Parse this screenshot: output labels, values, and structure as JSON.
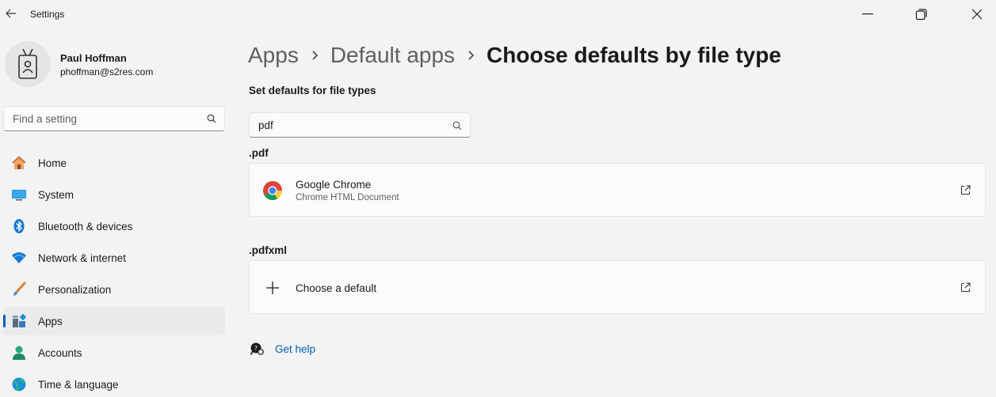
{
  "window": {
    "title": "Settings"
  },
  "profile": {
    "name": "Paul Hoffman",
    "email": "phoffman@s2res.com"
  },
  "search": {
    "placeholder": "Find a setting"
  },
  "nav": [
    {
      "label": "Home",
      "icon": "home-icon"
    },
    {
      "label": "System",
      "icon": "system-icon"
    },
    {
      "label": "Bluetooth & devices",
      "icon": "bluetooth-icon"
    },
    {
      "label": "Network & internet",
      "icon": "wifi-icon"
    },
    {
      "label": "Personalization",
      "icon": "brush-icon"
    },
    {
      "label": "Apps",
      "icon": "apps-icon",
      "active": true
    },
    {
      "label": "Accounts",
      "icon": "accounts-icon"
    },
    {
      "label": "Time & language",
      "icon": "globe-icon"
    }
  ],
  "breadcrumb": {
    "items": [
      "Apps",
      "Default apps",
      "Choose defaults by file type"
    ]
  },
  "main": {
    "section_title": "Set defaults for file types",
    "filter_value": "pdf",
    "groups": [
      {
        "extension": ".pdf",
        "app_name": "Google Chrome",
        "app_sub": "Chrome HTML Document",
        "icon": "chrome-icon"
      },
      {
        "extension": ".pdfxml",
        "app_name": "Choose a default",
        "icon": "plus-icon"
      }
    ],
    "help_label": "Get help"
  },
  "colors": {
    "accent": "#005fb8",
    "background": "#f3f3f3",
    "card": "#fbfbfb"
  }
}
